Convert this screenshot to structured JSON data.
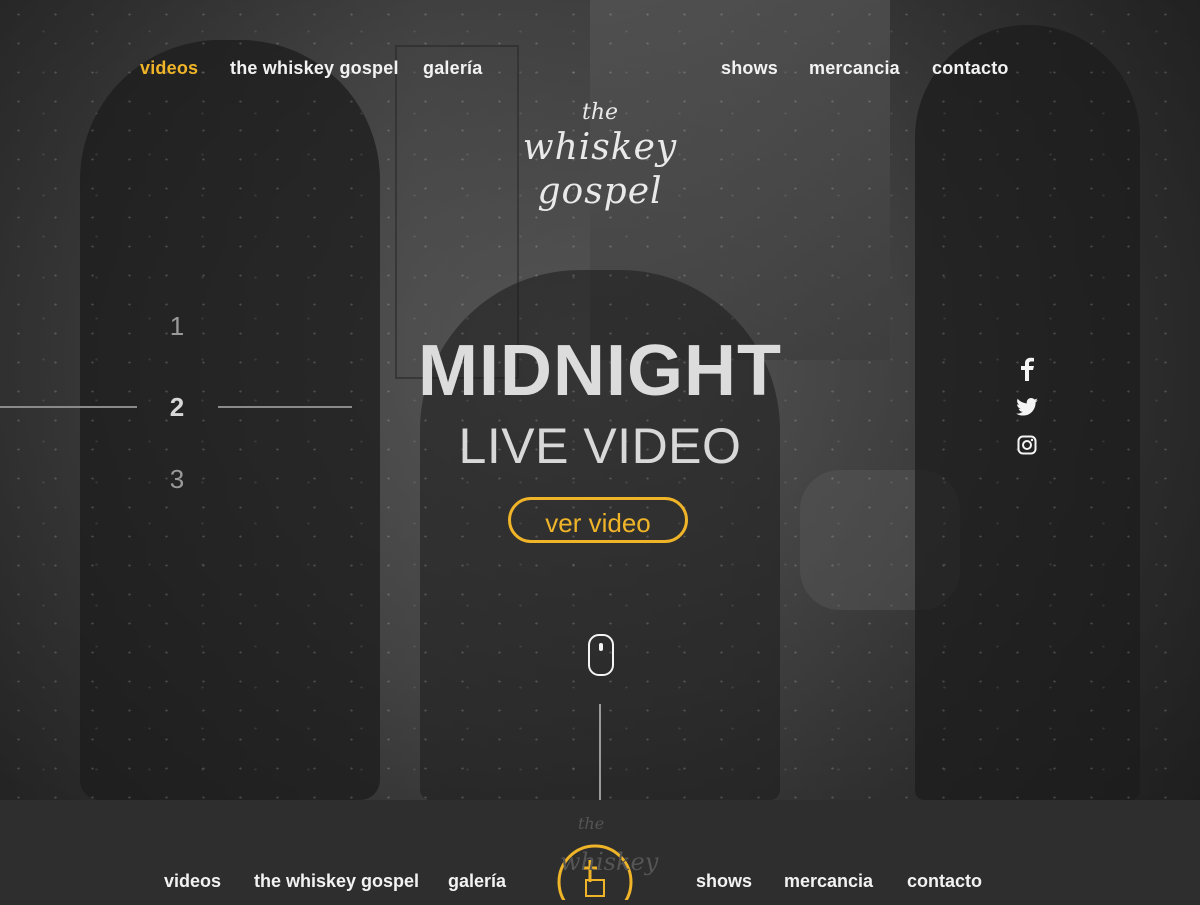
{
  "nav": {
    "left": [
      "videos",
      "the whiskey gospel",
      "galería"
    ],
    "right": [
      "shows",
      "mercancia",
      "contacto"
    ],
    "active": "videos"
  },
  "logo": {
    "line1": "the",
    "line2": "whiskey",
    "line3": "gospel"
  },
  "slides": {
    "items": [
      "1",
      "2",
      "3"
    ],
    "active_index": 1
  },
  "hero": {
    "title": "MIDNIGHT",
    "subtitle": "LIVE VIDEO",
    "cta_label": "ver video"
  },
  "social": [
    {
      "name": "facebook-icon"
    },
    {
      "name": "twitter-icon"
    },
    {
      "name": "instagram-icon"
    }
  ],
  "footer": {
    "left": [
      "videos",
      "the whiskey gospel",
      "galería"
    ],
    "right": [
      "shows",
      "mercancia",
      "contacto"
    ],
    "logo_line1": "the",
    "logo_line2": "whiskey"
  },
  "colors": {
    "accent": "#f0b429",
    "text": "#f2f2f2",
    "muted": "#9a9a9a",
    "footer_bg": "#2e2e2e"
  }
}
